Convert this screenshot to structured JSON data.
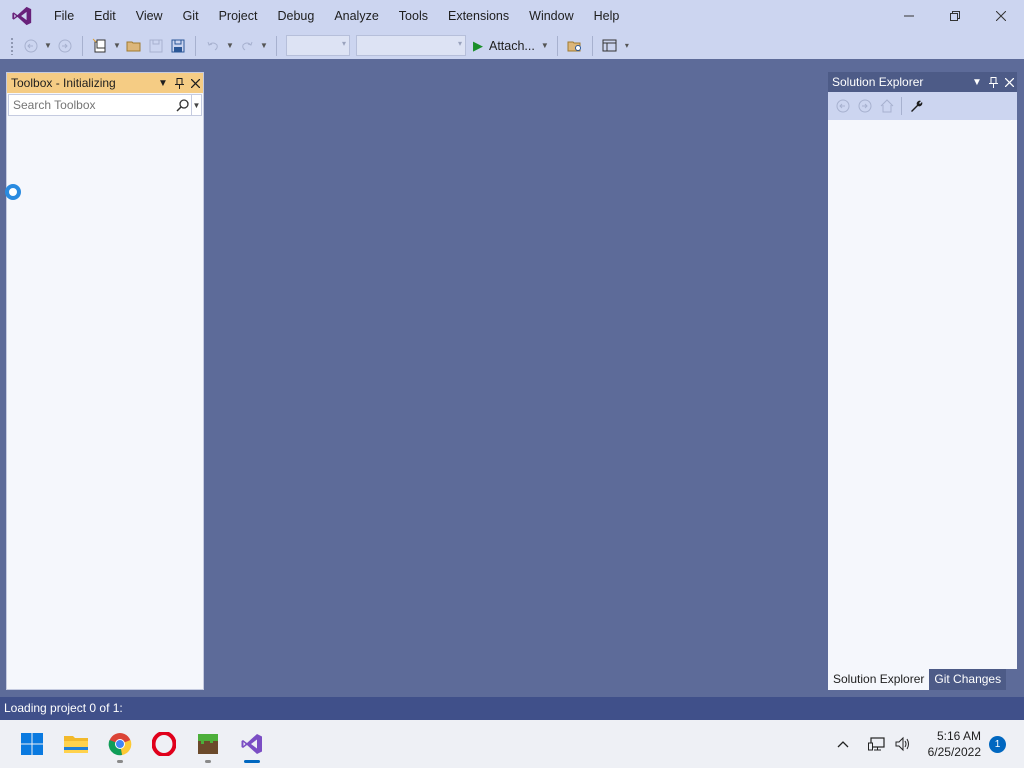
{
  "menu": {
    "items": [
      {
        "key": "file",
        "label": "File"
      },
      {
        "key": "edit",
        "label": "Edit"
      },
      {
        "key": "view",
        "label": "View"
      },
      {
        "key": "git",
        "label": "Git"
      },
      {
        "key": "project",
        "label": "Project"
      },
      {
        "key": "debug",
        "label": "Debug"
      },
      {
        "key": "analyze",
        "label": "Analyze"
      },
      {
        "key": "tools",
        "label": "Tools"
      },
      {
        "key": "extensions",
        "label": "Extensions"
      },
      {
        "key": "window",
        "label": "Window"
      },
      {
        "key": "help",
        "label": "Help"
      }
    ]
  },
  "toolbar": {
    "attach_label": "Attach..."
  },
  "toolbox": {
    "title": "Toolbox - Initializing",
    "search_placeholder": "Search Toolbox"
  },
  "solution_explorer": {
    "title": "Solution Explorer",
    "tabs": [
      "Solution Explorer",
      "Git Changes"
    ]
  },
  "status": {
    "text": "Loading project 0 of 1:"
  },
  "taskbar": {
    "apps": [
      "start-icon",
      "file-explorer-icon",
      "chrome-icon",
      "opera-icon",
      "minecraft-icon",
      "visual-studio-icon"
    ],
    "time": "5:16 AM",
    "date": "6/25/2022",
    "notification_count": "1"
  },
  "colors": {
    "accent": "#68217a",
    "toolbox_header": "#f5cc84",
    "workspace": "#5d6b99",
    "statusbar": "#40508a"
  }
}
